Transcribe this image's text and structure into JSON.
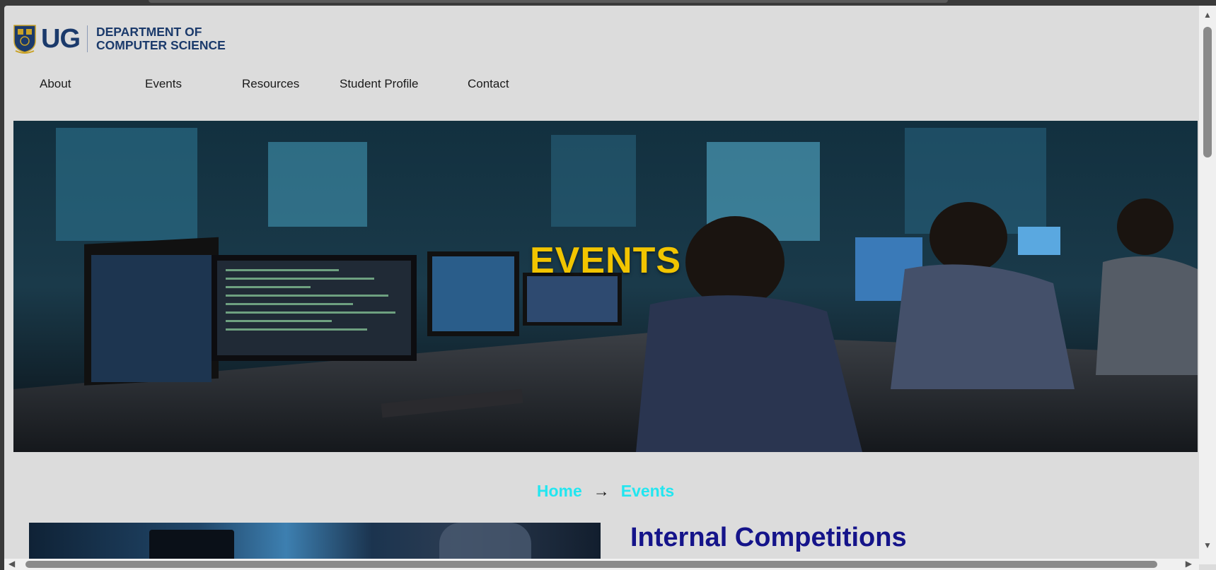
{
  "header": {
    "logo_ug": "UG",
    "dept_line1": "DEPARTMENT OF",
    "dept_line2": "COMPUTER SCIENCE"
  },
  "nav": {
    "items": [
      {
        "label": "About"
      },
      {
        "label": "Events"
      },
      {
        "label": "Resources"
      },
      {
        "label": "Student Profile"
      },
      {
        "label": "Contact"
      }
    ]
  },
  "hero": {
    "title": "EVENTS"
  },
  "breadcrumb": {
    "home": "Home",
    "separator": "→",
    "current": "Events"
  },
  "content": {
    "section_title": "Internal Competitions"
  },
  "colors": {
    "brand_navy": "#1b3a6b",
    "hero_title": "#f2c500",
    "breadcrumb_link": "#22e6f0",
    "section_title": "#15148a"
  }
}
